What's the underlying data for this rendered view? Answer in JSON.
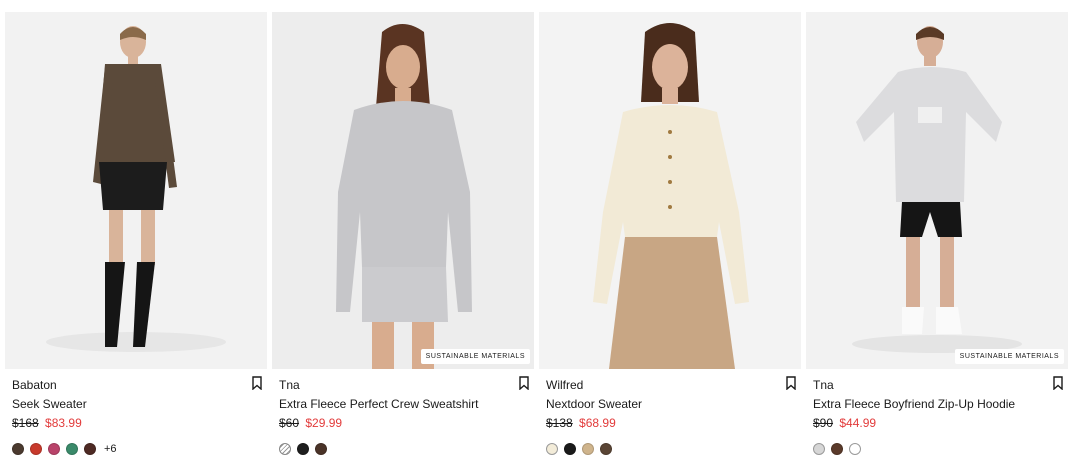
{
  "products": [
    {
      "brand": "Babaton",
      "name": "Seek Sweater",
      "old_price": "$168",
      "new_price": "$83.99",
      "badge": "",
      "swatches": [
        "#4b3a2f",
        "#c83a2c",
        "#b9436a",
        "#3a8a6a",
        "#4e2a24"
      ],
      "more_colors": "+6"
    },
    {
      "brand": "Tna",
      "name": "Extra Fleece Perfect Crew Sweatshirt",
      "old_price": "$60",
      "new_price": "$29.99",
      "badge": "SUSTAINABLE MATERIALS",
      "swatches": [
        "striped",
        "#1e1e1e",
        "#4a3328"
      ],
      "more_colors": ""
    },
    {
      "brand": "Wilfred",
      "name": "Nextdoor Sweater",
      "old_price": "$138",
      "new_price": "$68.99",
      "badge": "",
      "swatches": [
        "#f3ecd9",
        "#1a1a1a",
        "#cfb48c",
        "#5a4535"
      ],
      "more_colors": ""
    },
    {
      "brand": "Tna",
      "name": "Extra Fleece Boyfriend Zip-Up Hoodie",
      "old_price": "$90",
      "new_price": "$44.99",
      "badge": "SUSTAINABLE MATERIALS",
      "swatches": [
        "#d6d6d6",
        "#5a3a2a",
        "#ffffff"
      ],
      "more_colors": ""
    }
  ],
  "colors": {
    "sale": "#e23b3b",
    "text": "#1a1a1a",
    "photo_bg": "#f1f1f1"
  },
  "icons": {
    "bookmark": "bookmark-icon"
  }
}
